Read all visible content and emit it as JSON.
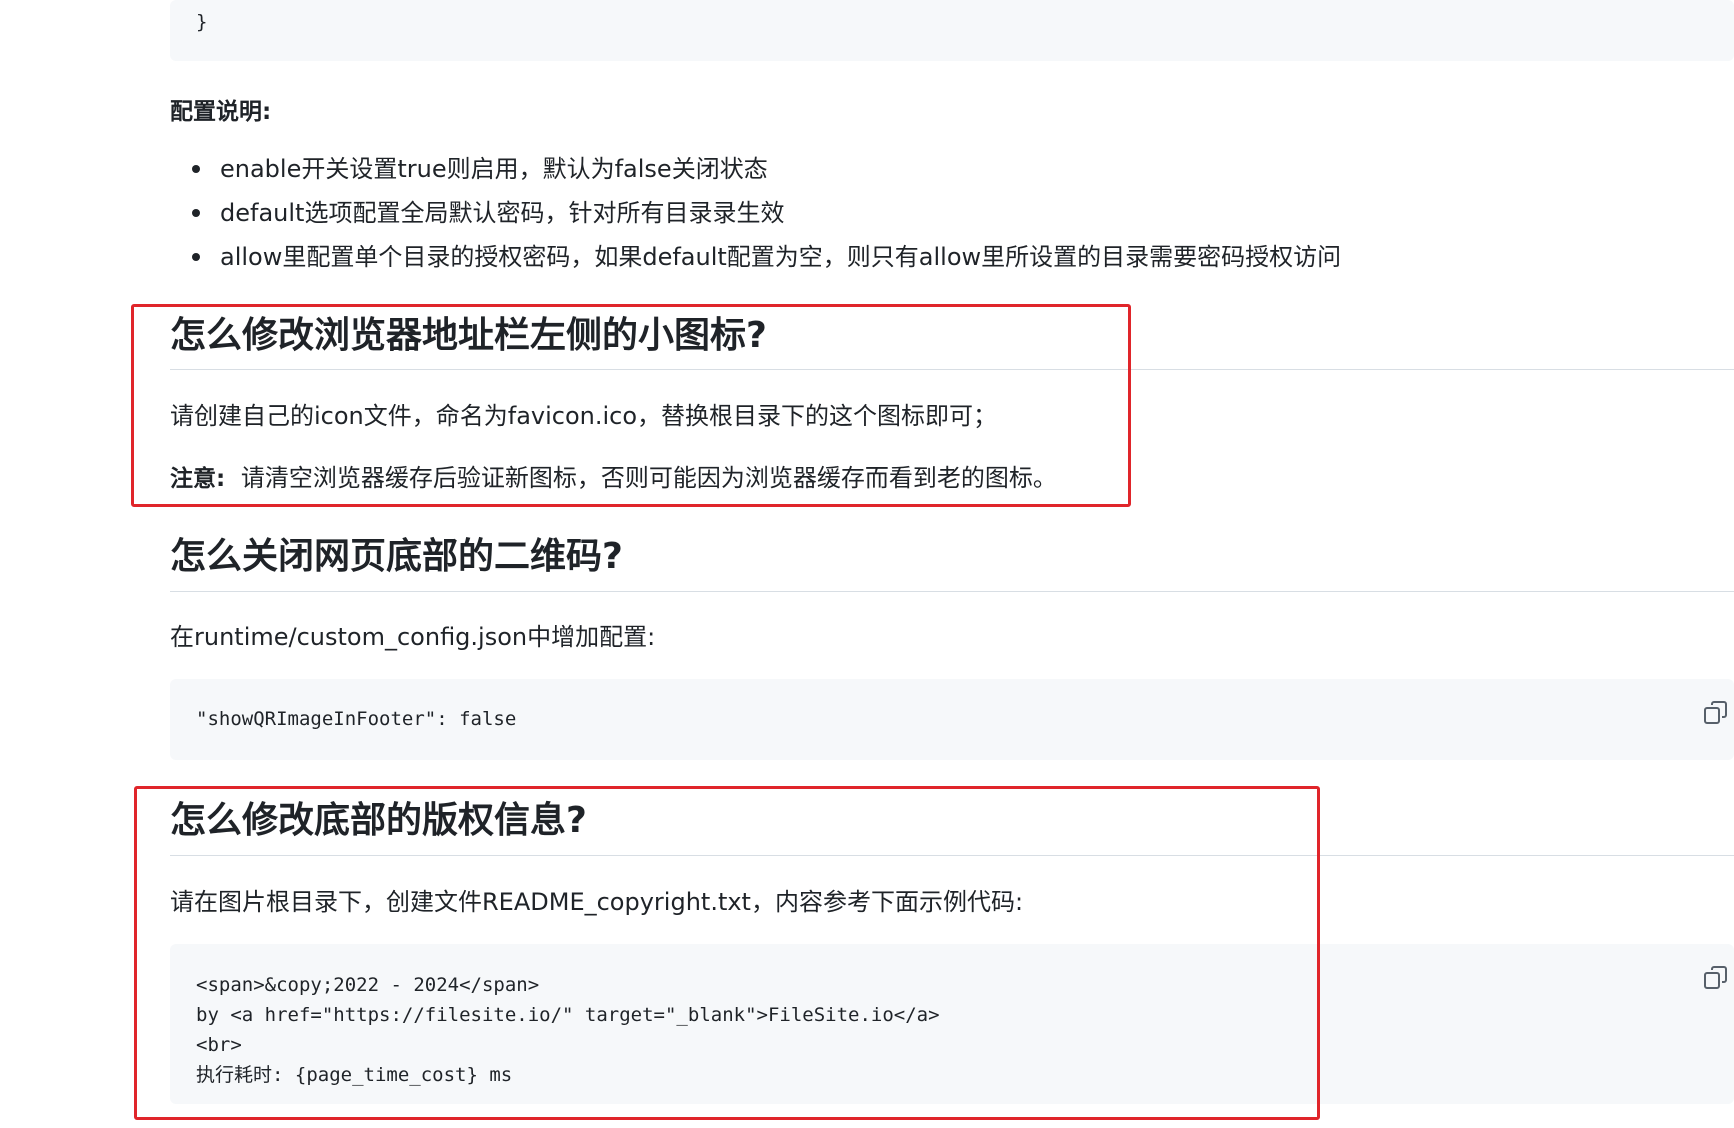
{
  "top_code": {
    "closing_brace": "}"
  },
  "config_section": {
    "label": "配置说明:",
    "items": [
      "enable开关设置true则启用，默认为false关闭状态",
      "default选项配置全局默认密码，针对所有目录录生效",
      "allow里配置单个目录的授权密码，如果default配置为空，则只有allow里所设置的目录需要密码授权访问"
    ]
  },
  "favicon_section": {
    "heading": "怎么修改浏览器地址栏左侧的小图标?",
    "paragraph": "请创建自己的icon文件，命名为favicon.ico，替换根目录下的这个图标即可；",
    "note_label": "注意:",
    "note_text": "请清空浏览器缓存后验证新图标，否则可能因为浏览器缓存而看到老的图标。"
  },
  "qr_section": {
    "heading": "怎么关闭网页底部的二维码?",
    "paragraph": "在runtime/custom_config.json中增加配置:",
    "code": "\"showQRImageInFooter\": false"
  },
  "copyright_section": {
    "heading": "怎么修改底部的版权信息?",
    "paragraph": "请在图片根目录下，创建文件README_copyright.txt，内容参考下面示例代码:",
    "code_lines": [
      "<span>&copy;2022 - 2024</span>",
      "by <a href=\"https://filesite.io/\" target=\"_blank\">FileSite.io</a>",
      "<br>",
      "执行耗时: {page_time_cost} ms"
    ]
  },
  "colors": {
    "highlight_box": "#e0252a",
    "code_background": "#f6f8fa",
    "text": "#1f2328"
  },
  "icons": {
    "copy": "copy-icon"
  }
}
